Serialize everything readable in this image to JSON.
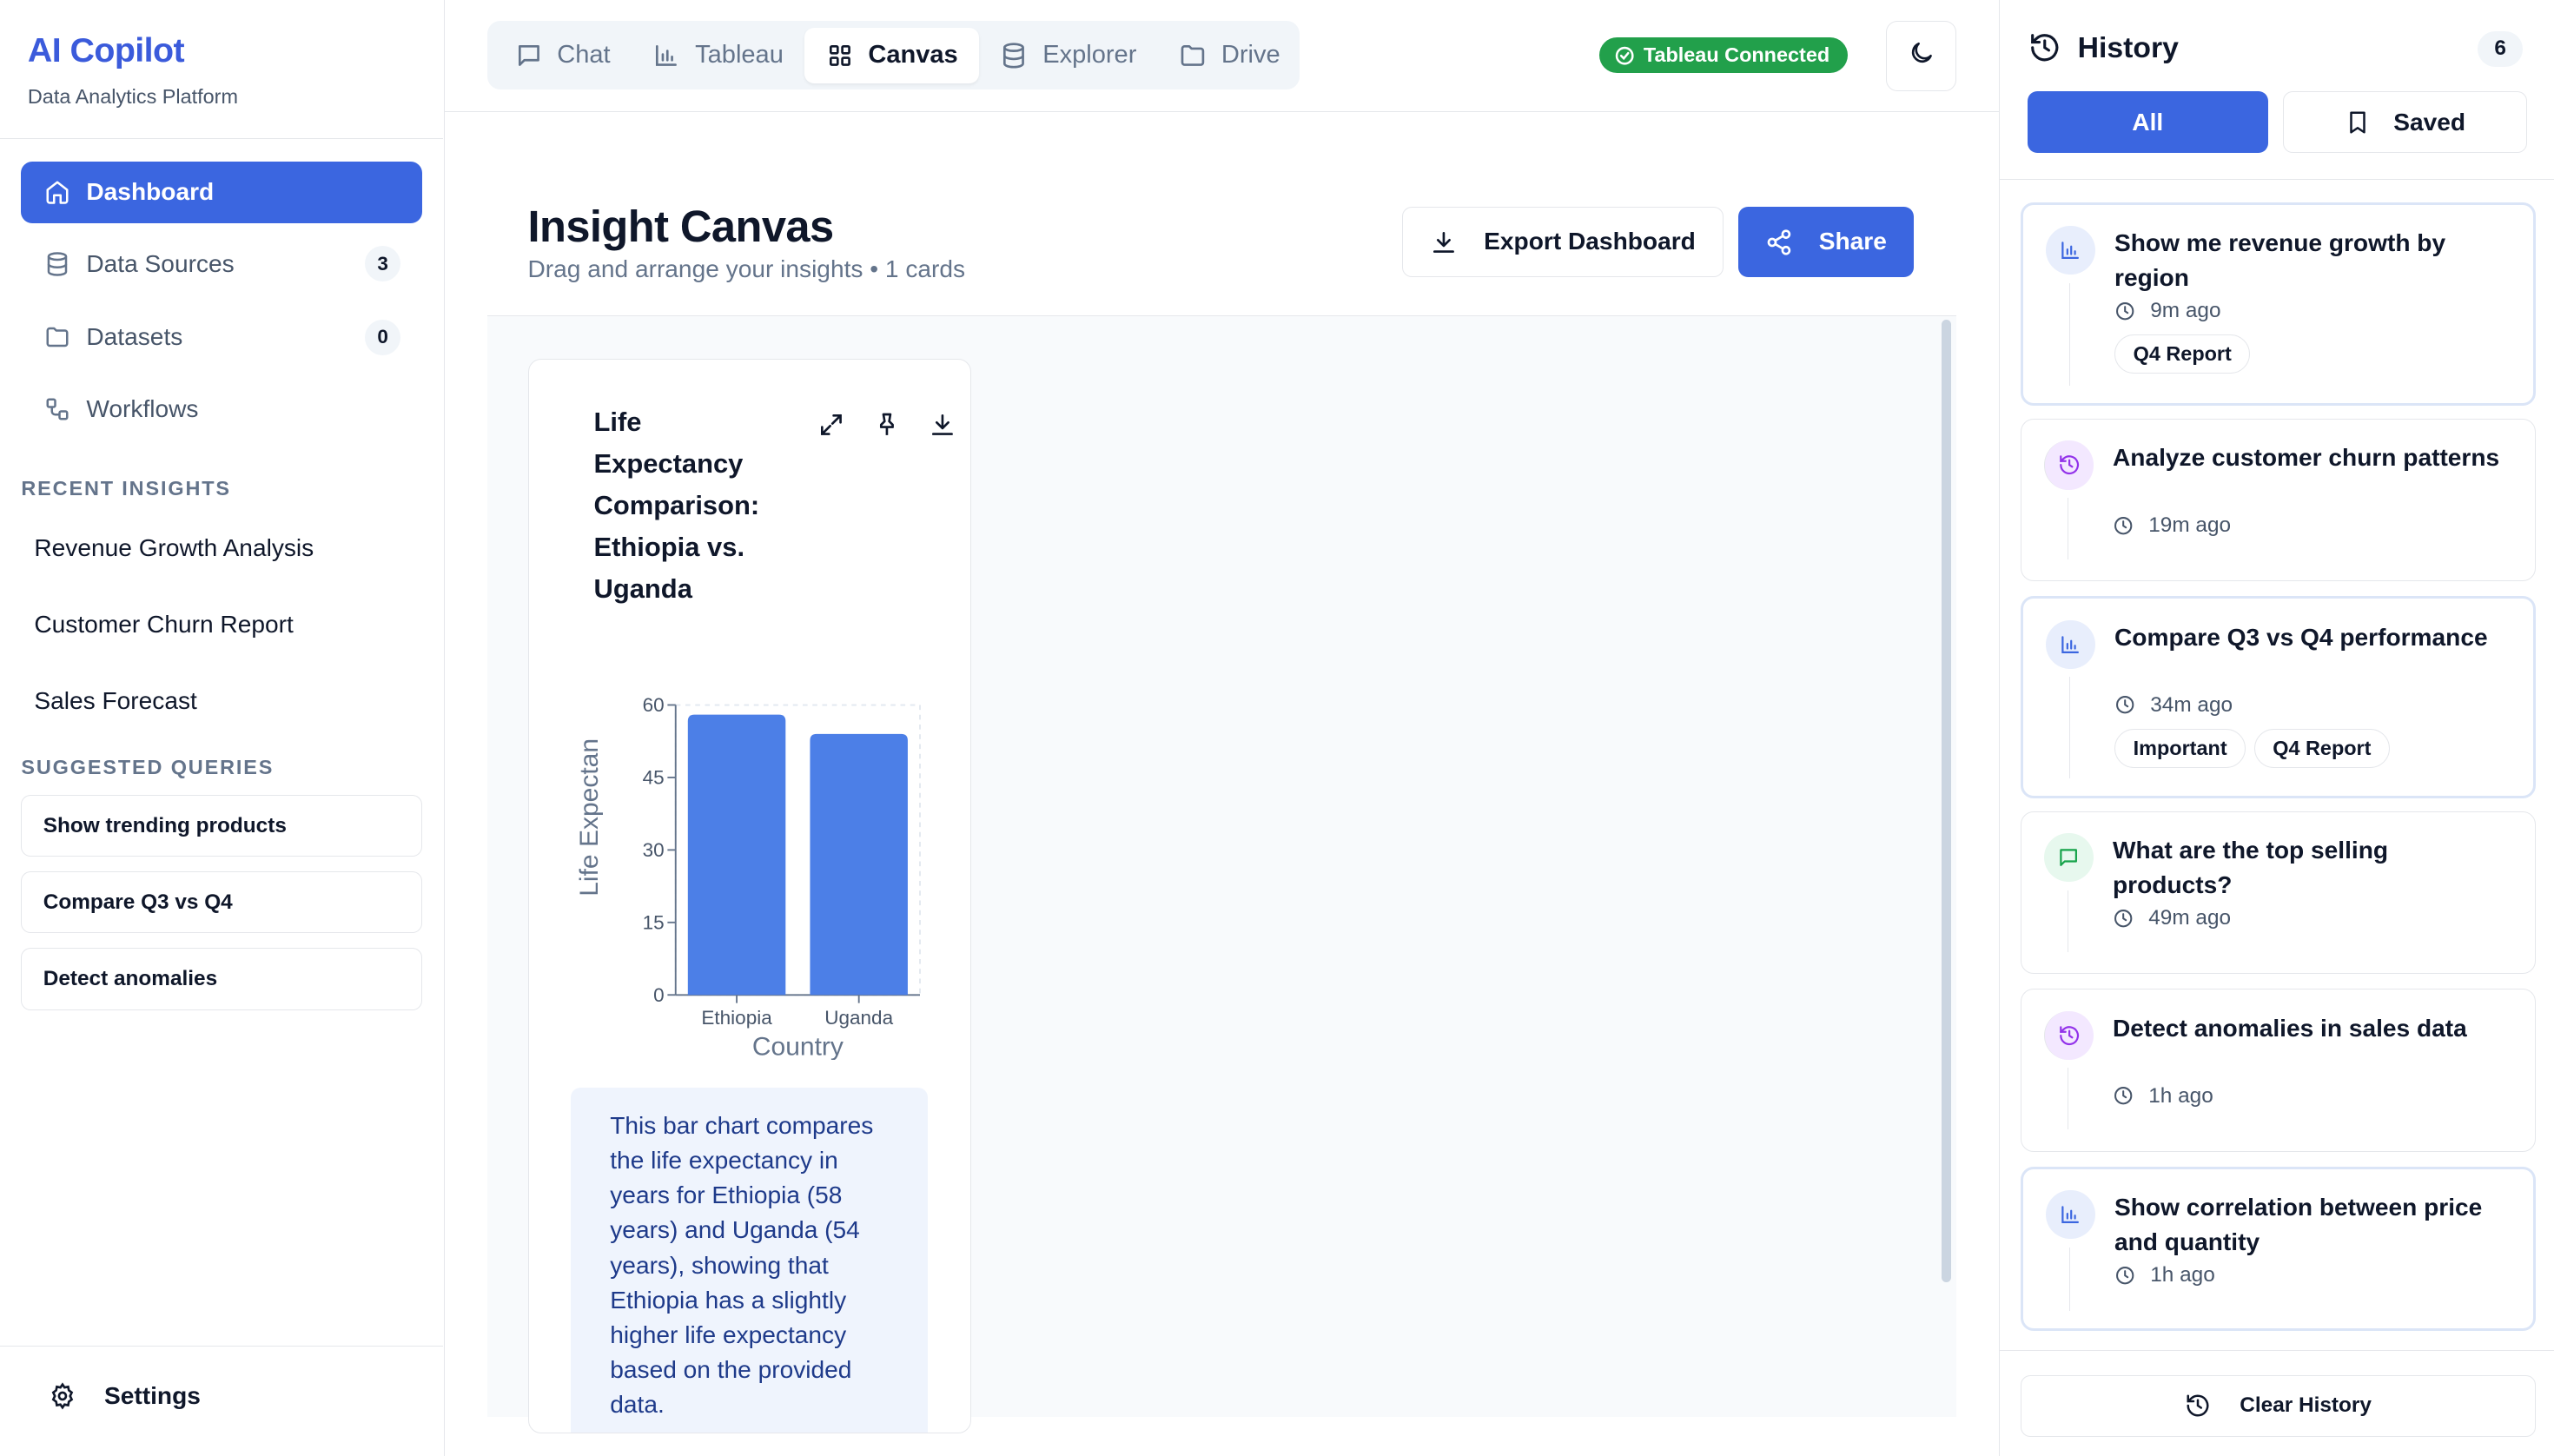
{
  "brand": {
    "title": "AI Copilot",
    "subtitle": "Data Analytics Platform"
  },
  "sidebar": {
    "nav": [
      {
        "label": "Dashboard",
        "icon": "home-icon",
        "active": true
      },
      {
        "label": "Data Sources",
        "icon": "database-icon",
        "count": "3"
      },
      {
        "label": "Datasets",
        "icon": "folder-icon",
        "count": "0"
      },
      {
        "label": "Workflows",
        "icon": "workflow-icon"
      }
    ],
    "recent_label": "RECENT INSIGHTS",
    "recent": [
      "Revenue Growth Analysis",
      "Customer Churn Report",
      "Sales Forecast"
    ],
    "suggested_label": "SUGGESTED QUERIES",
    "suggested": [
      "Show trending products",
      "Compare Q3 vs Q4",
      "Detect anomalies"
    ],
    "settings_label": "Settings"
  },
  "topnav": {
    "tabs": [
      {
        "label": "Chat",
        "icon": "chat-icon"
      },
      {
        "label": "Tableau",
        "icon": "bar-chart-icon"
      },
      {
        "label": "Canvas",
        "icon": "grid-icon",
        "active": true
      },
      {
        "label": "Explorer",
        "icon": "database-icon"
      },
      {
        "label": "Drive",
        "icon": "folder-icon"
      }
    ],
    "status": "Tableau Connected",
    "status_color": "#22a04b"
  },
  "canvas": {
    "title": "Insight Canvas",
    "subtitle": "Drag and arrange your insights • 1 cards",
    "export_label": "Export Dashboard",
    "share_label": "Share",
    "card": {
      "title": "Life Expectancy Comparison: Ethiopia vs. Uganda",
      "summary": "This bar chart compares the life expectancy in years for Ethiopia (58 years) and Uganda (54 years), showing that Ethiopia has a slightly higher life expectancy based on the provided data."
    }
  },
  "chart_data": {
    "type": "bar",
    "categories": [
      "Ethiopia",
      "Uganda"
    ],
    "series": [
      {
        "name": "value",
        "values": [
          58,
          54
        ]
      }
    ],
    "xlabel": "Country",
    "ylabel": "Life Expectan",
    "ylim": [
      0,
      60
    ],
    "yticks": [
      0,
      15,
      30,
      45,
      60
    ],
    "grid": true,
    "legend": "bottom",
    "color": "#4c7fe7"
  },
  "history": {
    "title": "History",
    "count": "6",
    "filter_all": "All",
    "filter_saved": "Saved",
    "items": [
      {
        "text": "Show me revenue growth by region",
        "time": "9m ago",
        "icon": "chart-icon",
        "tags": [
          "Q4 Report"
        ]
      },
      {
        "text": "Analyze customer churn patterns",
        "time": "19m ago",
        "icon": "history-icon",
        "tags": []
      },
      {
        "text": "Compare Q3 vs Q4 performance",
        "time": "34m ago",
        "icon": "chart-icon",
        "tags": [
          "Important",
          "Q4 Report"
        ]
      },
      {
        "text": "What are the top selling products?",
        "time": "49m ago",
        "icon": "chat-icon",
        "tags": []
      },
      {
        "text": "Detect anomalies in sales data",
        "time": "1h ago",
        "icon": "history-icon",
        "tags": []
      },
      {
        "text": "Show correlation between price and quantity",
        "time": "1h ago",
        "icon": "chart-icon",
        "tags": []
      }
    ],
    "clear_label": "Clear History"
  },
  "colors": {
    "accent": "#3b66e0",
    "brand": "#3b5bdb",
    "success": "#22a04b"
  }
}
